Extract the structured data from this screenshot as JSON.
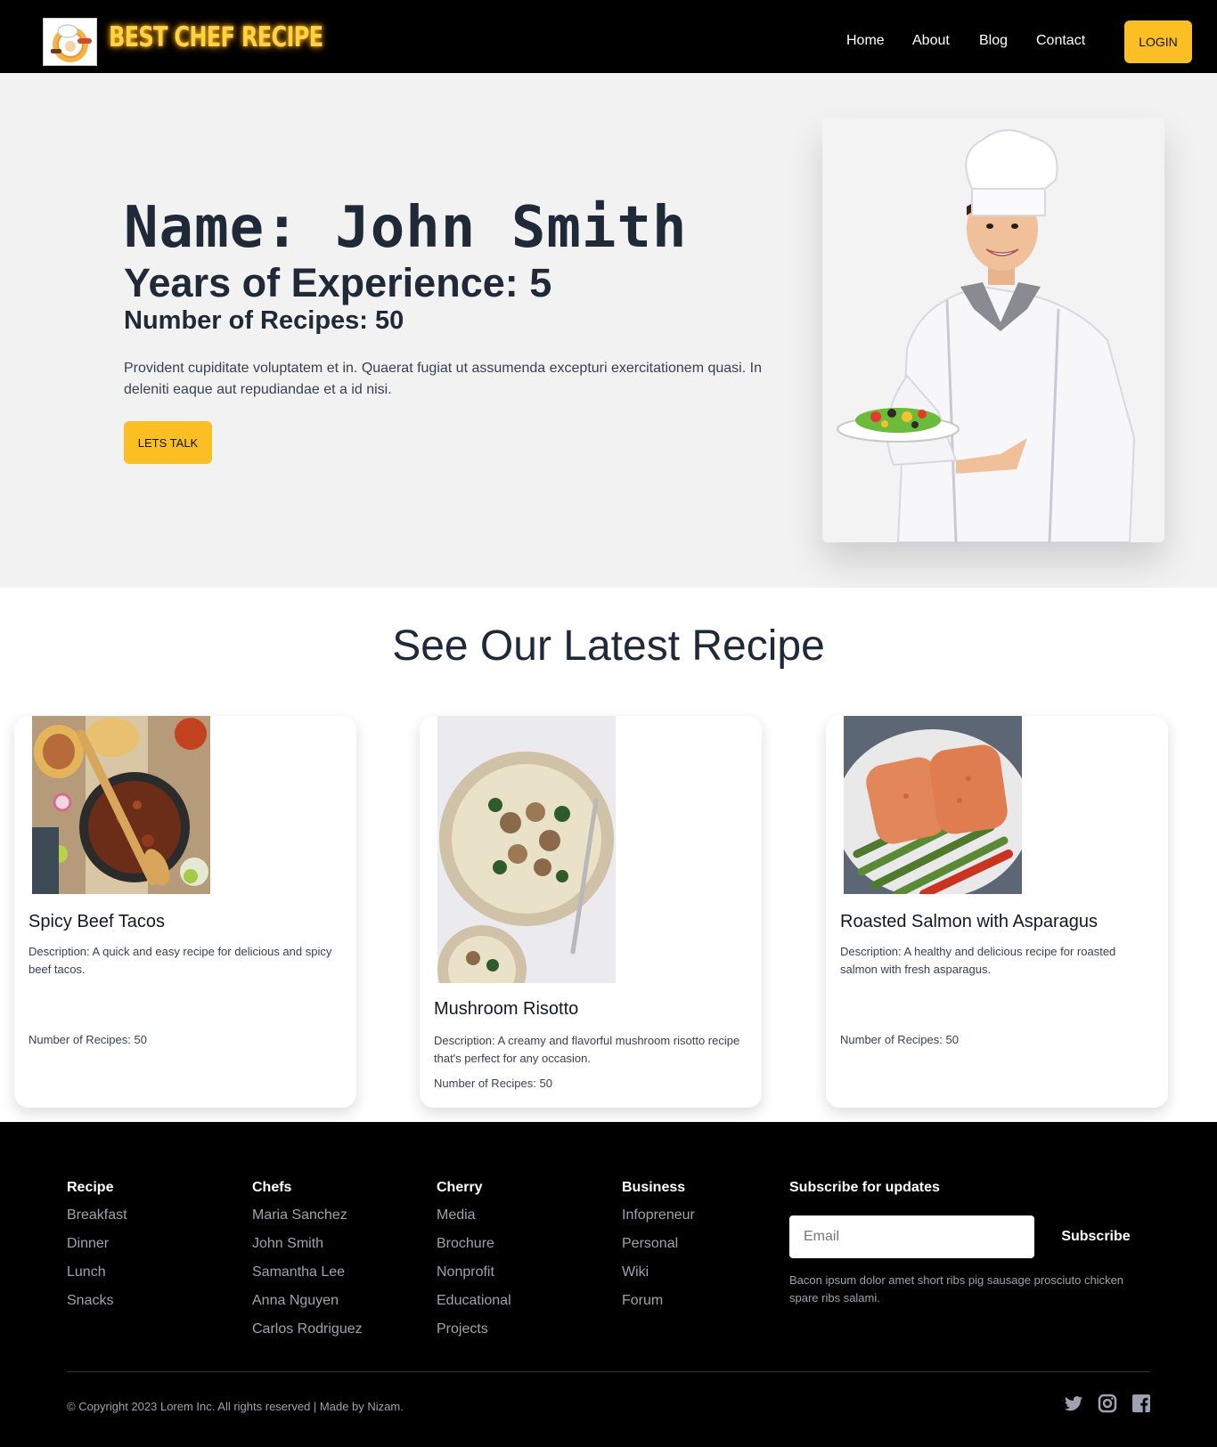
{
  "navbar": {
    "brand": "BEST CHEF RECIPE",
    "links": [
      "Home",
      "About",
      "Blog",
      "Contact"
    ],
    "login": "LOGIN"
  },
  "hero": {
    "name": "Name: John Smith",
    "experience": "Years of Experience: 5",
    "recipes": "Number of Recipes: 50",
    "description": "Provident cupiditate voluptatem et in. Quaerat fugiat ut assumenda excepturi exercitationem quasi. In deleniti eaque aut repudiandae et a id nisi.",
    "cta": "LETS TALK"
  },
  "recipes": {
    "title": "See Our Latest Recipe",
    "cards": [
      {
        "title": "Spicy Beef Tacos",
        "description": "Description: A quick and easy recipe for delicious and spicy beef tacos.",
        "count": "Number of Recipes: 50"
      },
      {
        "title": "Mushroom Risotto",
        "description": "Description: A creamy and flavorful mushroom risotto recipe that's perfect for any occasion.",
        "count": "Number of Recipes: 50"
      },
      {
        "title": "Roasted Salmon with Asparagus",
        "description": "Description: A healthy and delicious recipe for roasted salmon with fresh asparagus.",
        "count": "Number of Recipes: 50"
      }
    ]
  },
  "footer": {
    "columns": [
      {
        "heading": "Recipe",
        "links": [
          "Breakfast",
          "Dinner",
          "Lunch",
          "Snacks"
        ]
      },
      {
        "heading": "Chefs",
        "links": [
          "Maria Sanchez",
          "John Smith",
          "Samantha Lee",
          "Anna Nguyen",
          "Carlos Rodriguez"
        ]
      },
      {
        "heading": "Cherry",
        "links": [
          "Media",
          "Brochure",
          "Nonprofit",
          "Educational",
          "Projects"
        ]
      },
      {
        "heading": "Business",
        "links": [
          "Infopreneur",
          "Personal",
          "Wiki",
          "Forum"
        ]
      }
    ],
    "subscribe": {
      "heading": "Subscribe for updates",
      "placeholder": "Email",
      "button": "Subscribe",
      "description": "Bacon ipsum dolor amet short ribs pig sausage prosciuto chicken spare ribs salami."
    },
    "copyright": "© Copyright 2023 Lorem Inc. All rights reserved | Made by Nizam.",
    "social_icons": [
      "twitter-icon",
      "instagram-icon",
      "facebook-icon"
    ]
  },
  "colors": {
    "accent": "#fbbf24",
    "dark": "#000000",
    "hero_bg": "#f2f2f2",
    "brand_glow": "#ffd24a"
  }
}
